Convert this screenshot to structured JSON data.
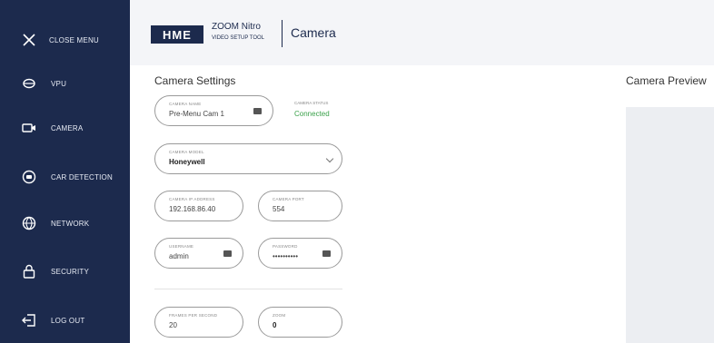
{
  "sidebar": {
    "items": [
      {
        "label": "Close Menu",
        "icon": "close-icon"
      },
      {
        "label": "VPU",
        "icon": "vpu-icon"
      },
      {
        "label": "Camera",
        "icon": "camera-icon"
      },
      {
        "label": "Car Detection",
        "icon": "car-detection-icon"
      },
      {
        "label": "Network",
        "icon": "network-icon"
      },
      {
        "label": "Security",
        "icon": "lock-icon"
      },
      {
        "label": "Log Out",
        "icon": "logout-icon"
      }
    ]
  },
  "header": {
    "logo": "HME",
    "product_line1": "ZOOM Nitro",
    "product_line2": "Video Setup Tool",
    "page_title": "Camera"
  },
  "settings": {
    "title": "Camera Settings",
    "camera_name": {
      "label": "Camera Name",
      "value": "Pre-Menu Cam 1"
    },
    "camera_status": {
      "label": "Camera Status",
      "value": "Connected"
    },
    "camera_model": {
      "label": "Camera Model",
      "value": "Honeywell"
    },
    "ip_address": {
      "label": "Camera IP Address",
      "value": "192.168.86.40"
    },
    "port": {
      "label": "Camera Port",
      "value": "554"
    },
    "username": {
      "label": "Username",
      "value": "admin"
    },
    "password": {
      "label": "Password",
      "value": "••••••••••"
    },
    "fps": {
      "label": "Frames Per Second",
      "value": "20"
    },
    "zoom": {
      "label": "Zoom",
      "value": "0"
    }
  },
  "preview": {
    "title": "Camera Preview"
  },
  "colors": {
    "sidebar": "#1c2a4d",
    "status_ok": "#3aa14a"
  }
}
